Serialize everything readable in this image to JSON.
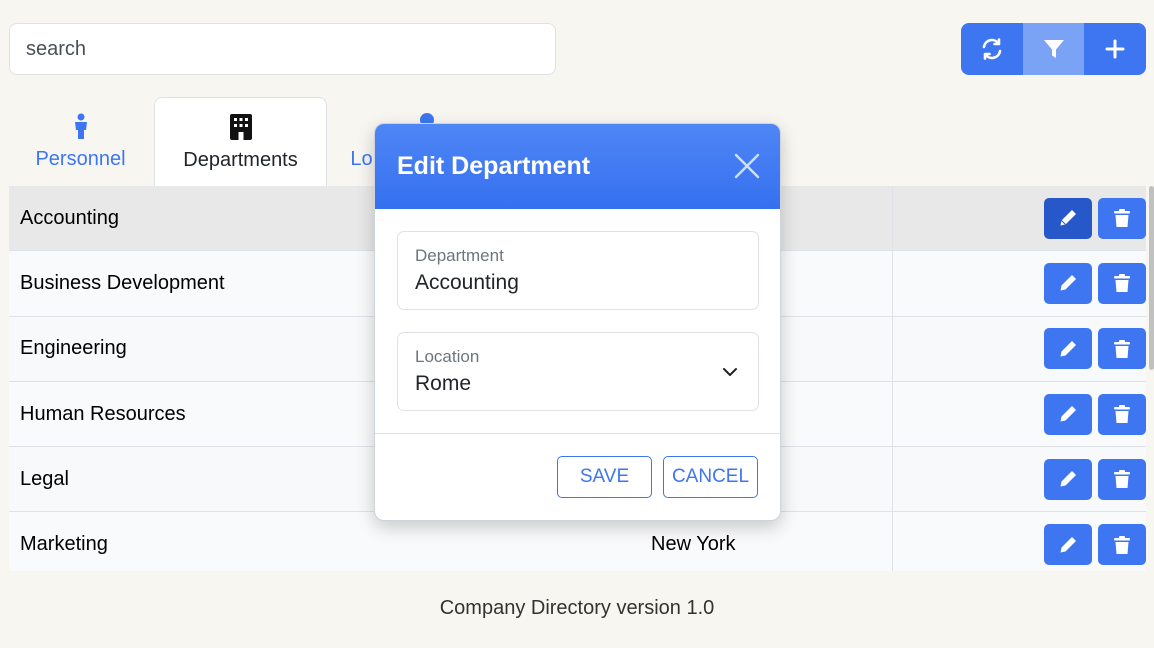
{
  "search": {
    "placeholder": "search"
  },
  "toolbar": {
    "buttons": [
      {
        "icon": "refresh-icon"
      },
      {
        "icon": "filter-icon",
        "active": true
      },
      {
        "icon": "plus-icon"
      }
    ]
  },
  "tabs": [
    {
      "label": "Personnel",
      "icon": "person-icon"
    },
    {
      "label": "Departments",
      "icon": "building-icon",
      "active": true
    },
    {
      "label": "Lo",
      "icon": "map-pin-icon"
    }
  ],
  "table": {
    "rows": [
      {
        "name": "Accounting",
        "location": ""
      },
      {
        "name": "Business Development",
        "location": ""
      },
      {
        "name": "Engineering",
        "location": ""
      },
      {
        "name": "Human Resources",
        "location": ""
      },
      {
        "name": "Legal",
        "location": ""
      },
      {
        "name": "Marketing",
        "location": "New York"
      }
    ]
  },
  "modal": {
    "title": "Edit Department",
    "department_label": "Department",
    "department_value": "Accounting",
    "location_label": "Location",
    "location_value": "Rome",
    "save_label": "SAVE",
    "cancel_label": "CANCEL"
  },
  "footer": {
    "text": "Company Directory version 1.0"
  },
  "colors": {
    "primary": "#3d76f0",
    "background": "#f8f6f1"
  }
}
